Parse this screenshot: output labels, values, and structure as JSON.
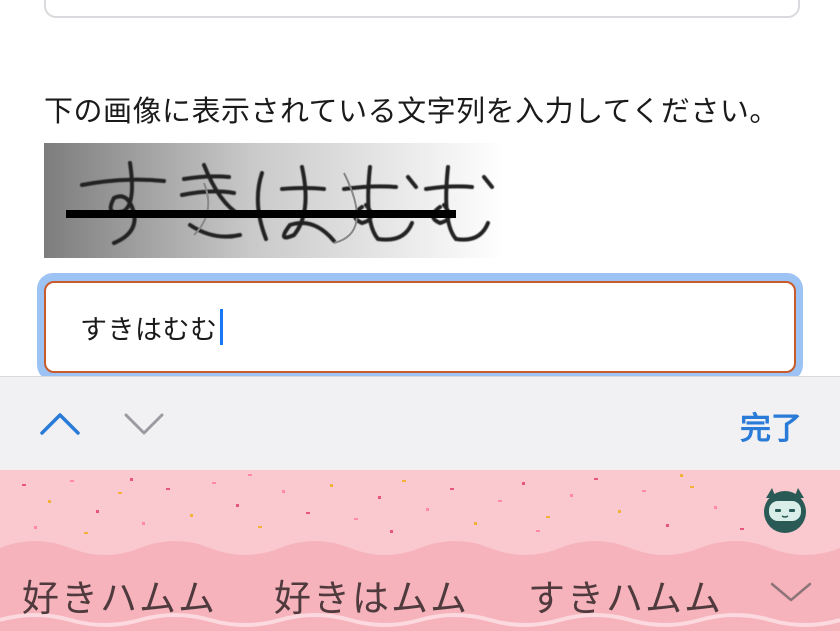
{
  "form": {
    "instruction": "下の画像に表示されている文字列を入力してください。",
    "captcha_text": "すきはむむ",
    "input_value": "すきはむむ"
  },
  "toolbar": {
    "up_icon": "chevron-up-icon",
    "down_icon": "chevron-down-icon",
    "done_label": "完了"
  },
  "keyboard": {
    "suggestions": [
      "好きハムム",
      "好きはムム",
      "すきハムム"
    ],
    "expand_icon": "chevron-down-icon",
    "mascot_icon": "keyboard-mascot-icon"
  },
  "colors": {
    "accent": "#2a7ad8",
    "input_border": "#c75b2c",
    "focus_ring": "#9cc3f3",
    "keyboard_bg": "#f9c9cf"
  }
}
